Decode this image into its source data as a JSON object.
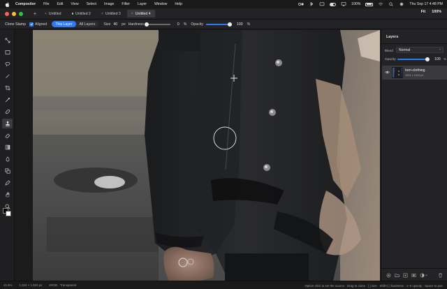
{
  "menubar": {
    "app_name": "Compositor",
    "items": [
      "File",
      "Edit",
      "View",
      "Select",
      "Image",
      "Filter",
      "Layer",
      "Window",
      "Help"
    ],
    "battery": "100%",
    "datetime": "Thu Sep 17  4:48 PM"
  },
  "tabs": [
    {
      "label": "Untitled",
      "active": false
    },
    {
      "label": "Untitled 2",
      "active": false
    },
    {
      "label": "Untitled 3",
      "active": false
    },
    {
      "label": "Untitled 4",
      "active": true
    }
  ],
  "tabbar_right": {
    "fit": "Fit",
    "zoom": "100%"
  },
  "options": {
    "tool_name": "Clone Stamp",
    "aligned_label": "Aligned",
    "aligned_checked": true,
    "sample_this_layer": "This Layer",
    "sample_all_layers": "All Layers",
    "size_label": "Size",
    "size_value": "40",
    "size_unit": "px",
    "hardness_label": "Hardness",
    "hardness_value": "0",
    "hardness_unit": "%",
    "opacity_label": "Opacity",
    "opacity_value": "100",
    "opacity_unit": "%",
    "hardness_fraction": 0.0,
    "opacity_fraction": 1.0
  },
  "tools": [
    "move-icon",
    "marquee-icon",
    "lasso-icon",
    "magic-wand-icon",
    "crop-icon",
    "eyedropper-icon",
    "healing-icon",
    "clone-stamp-icon",
    "eraser-icon",
    "gradient-icon",
    "burn-icon",
    "shape-icon",
    "pen-icon",
    "hand-icon",
    "zoom-icon"
  ],
  "layers_panel": {
    "title": "Layers",
    "blend_label": "Blend",
    "blend_value": "Normal",
    "opacity_label": "Opacity",
    "opacity_value": "100",
    "opacity_unit": "%",
    "opacity_fraction": 1.0,
    "layers": [
      {
        "name": "torn-clothing",
        "size": "1024 × 1024 px"
      }
    ]
  },
  "status": {
    "zoom": "41.5%",
    "dimensions": "1,024 × 1,024 px",
    "color_profile": "sRGB · Transparent",
    "hint": "Option-click to set the source · Drag to clone · [ ] size · Shift+[ ] hardness · 1–0 opacity · Space to pan"
  },
  "colors": {
    "accent": "#2f7bf5",
    "foreground_swatch": "#000000",
    "background_swatch": "#ffffff"
  }
}
